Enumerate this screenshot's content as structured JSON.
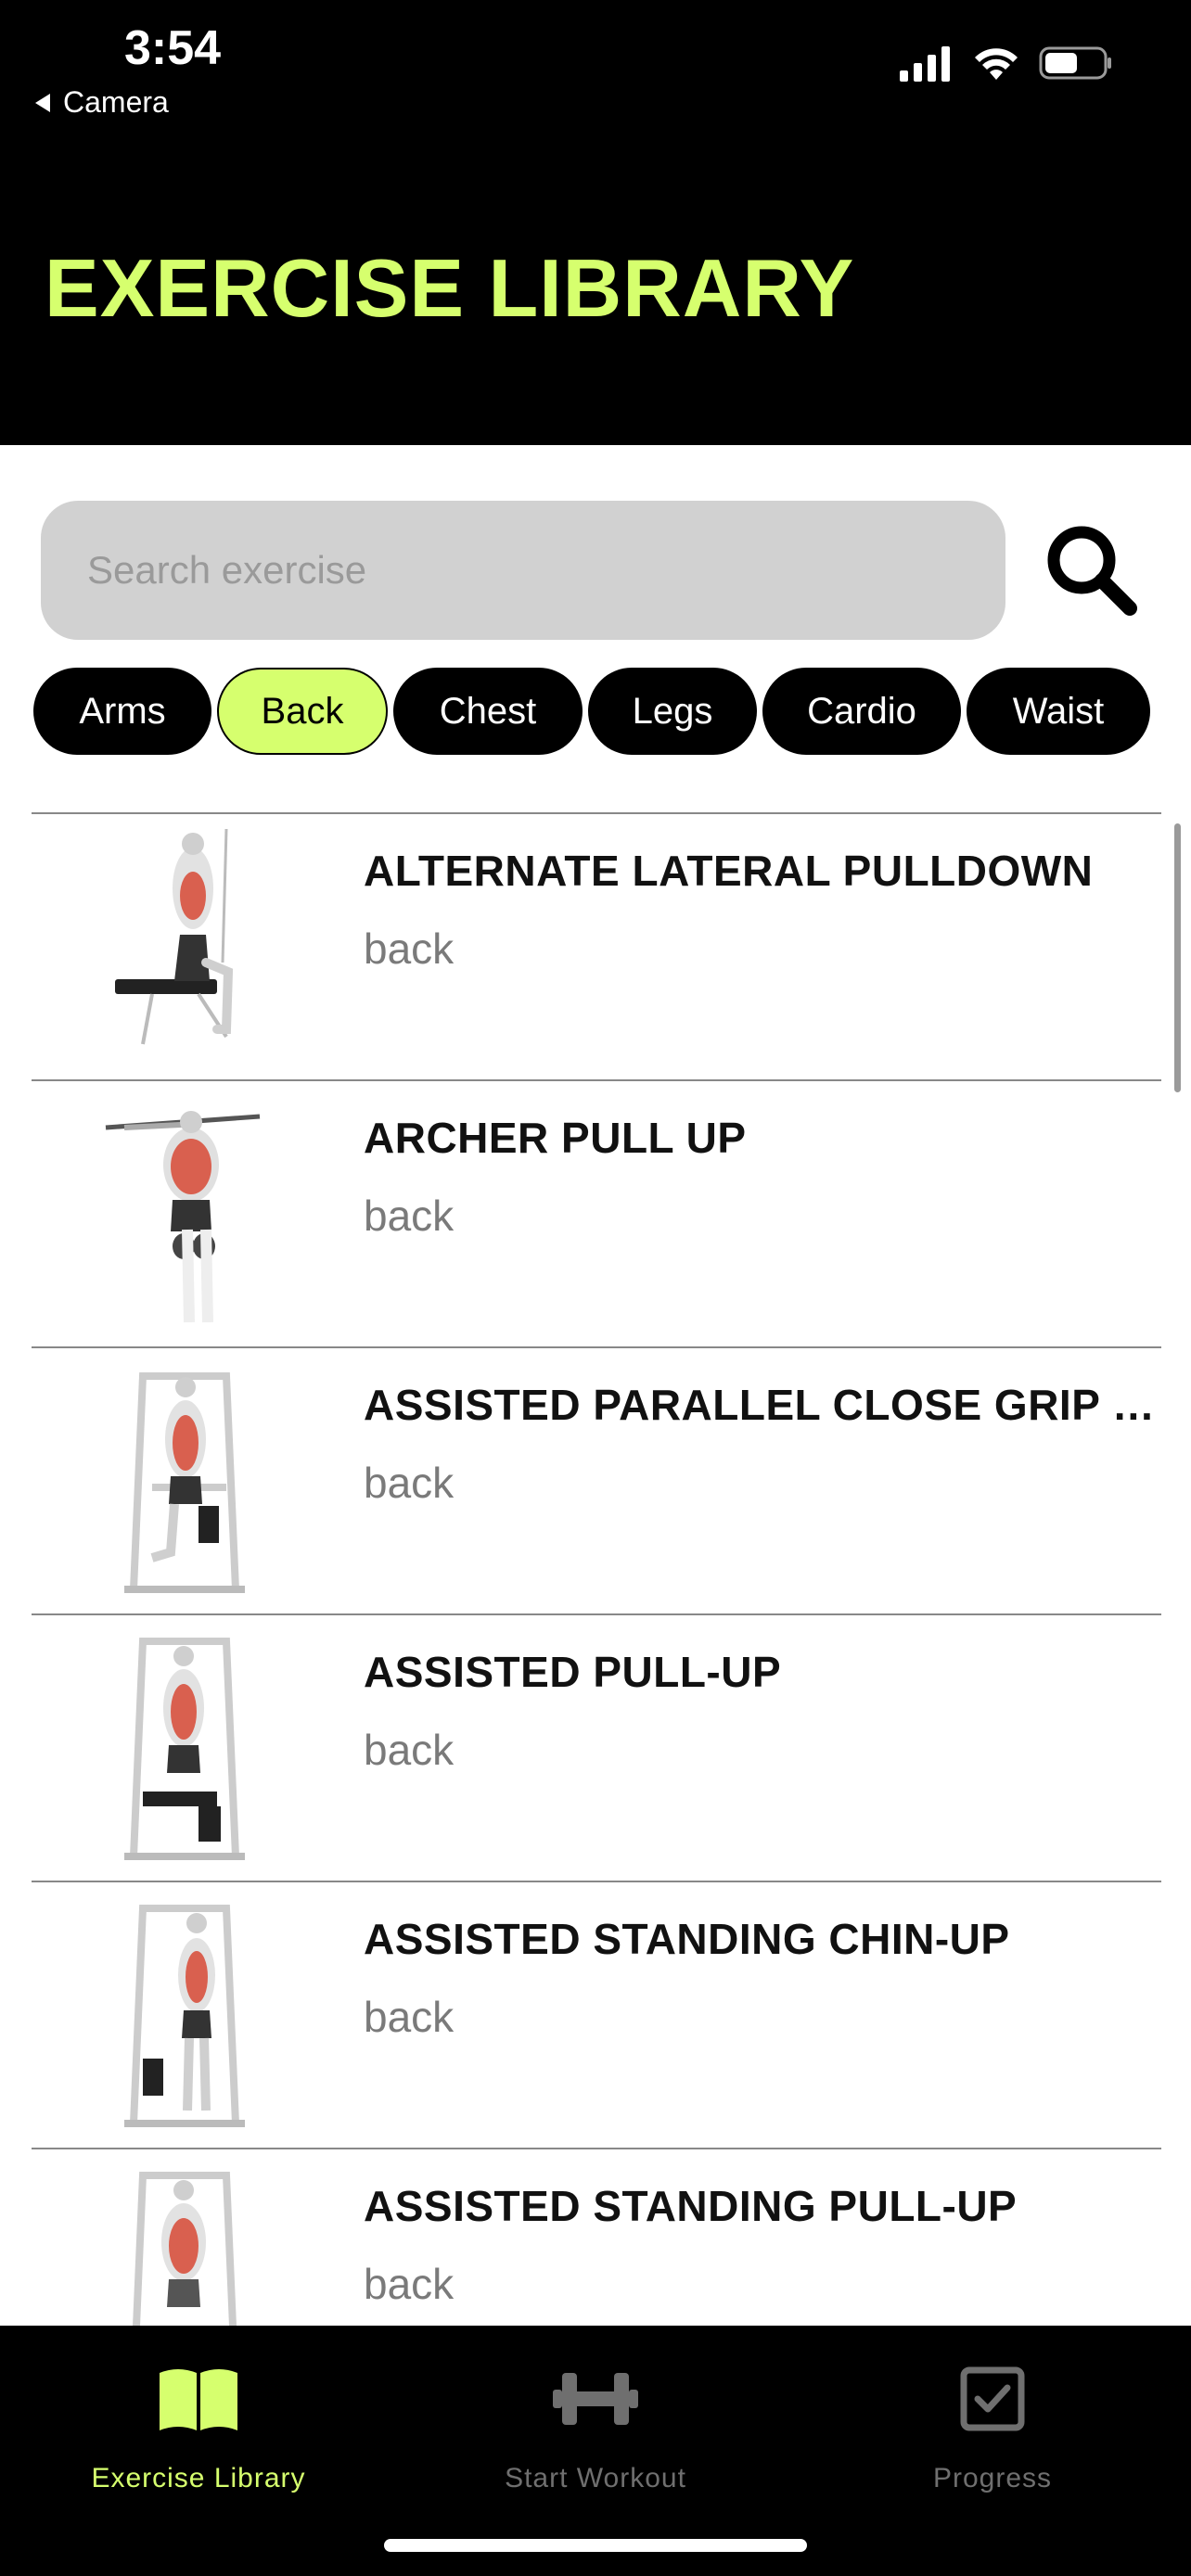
{
  "status_bar": {
    "time": "3:54",
    "back_label": "Camera"
  },
  "header": {
    "title": "EXERCISE LIBRARY"
  },
  "search": {
    "placeholder": "Search exercise"
  },
  "filters": [
    {
      "label": "Arms",
      "active": false
    },
    {
      "label": "Back",
      "active": true
    },
    {
      "label": "Chest",
      "active": false
    },
    {
      "label": "Legs",
      "active": false
    },
    {
      "label": "Cardio",
      "active": false
    },
    {
      "label": "Waist",
      "active": false
    }
  ],
  "exercises": [
    {
      "name": "ALTERNATE LATERAL PULLDOWN",
      "body_part": "back"
    },
    {
      "name": "ARCHER PULL UP",
      "body_part": "back"
    },
    {
      "name": "ASSISTED PARALLEL CLOSE GRIP PULL-UP",
      "body_part": "back"
    },
    {
      "name": "ASSISTED PULL-UP",
      "body_part": "back"
    },
    {
      "name": "ASSISTED STANDING CHIN-UP",
      "body_part": "back"
    },
    {
      "name": "ASSISTED STANDING PULL-UP",
      "body_part": "back"
    }
  ],
  "tabs": [
    {
      "label": "Exercise Library",
      "icon": "book-icon",
      "active": true
    },
    {
      "label": "Start Workout",
      "icon": "dumbbell-icon",
      "active": false
    },
    {
      "label": "Progress",
      "icon": "checkbox-icon",
      "active": false
    }
  ],
  "colors": {
    "accent": "#d6ff6e",
    "background": "#000000",
    "inactive": "#6f6f6f"
  }
}
